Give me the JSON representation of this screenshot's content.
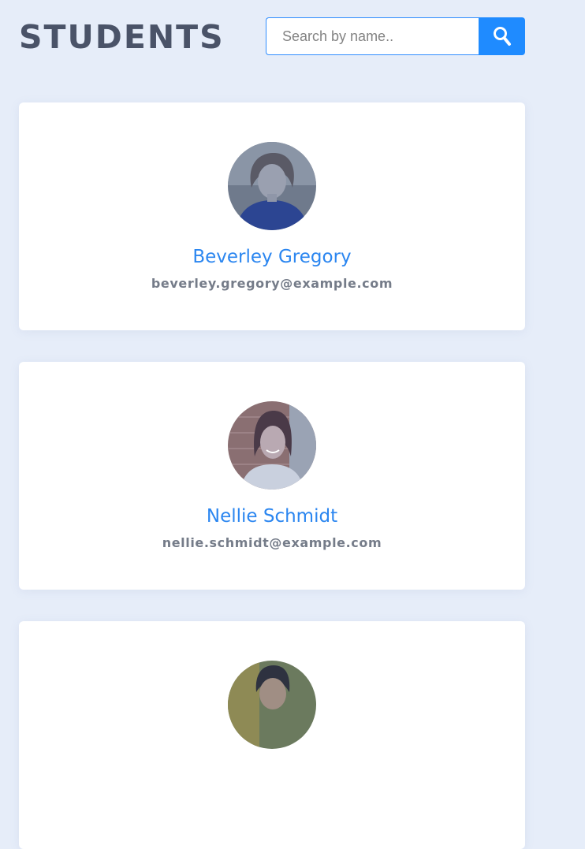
{
  "header": {
    "title": "STUDENTS",
    "search": {
      "placeholder": "Search by name..",
      "value": "",
      "button_icon": "search-icon"
    }
  },
  "colors": {
    "background": "#e6edf9",
    "accent": "#1f8bff",
    "name": "#2b86f0",
    "email": "#757c89",
    "title": "#4a5368"
  },
  "students": [
    {
      "name": "Beverley Gregory",
      "email": "beverley.gregory@example.com",
      "avatar_icon": "avatar-photo-icon"
    },
    {
      "name": "Nellie Schmidt",
      "email": "nellie.schmidt@example.com",
      "avatar_icon": "avatar-photo-icon"
    },
    {
      "name": "",
      "email": "",
      "avatar_icon": "avatar-photo-icon"
    }
  ]
}
